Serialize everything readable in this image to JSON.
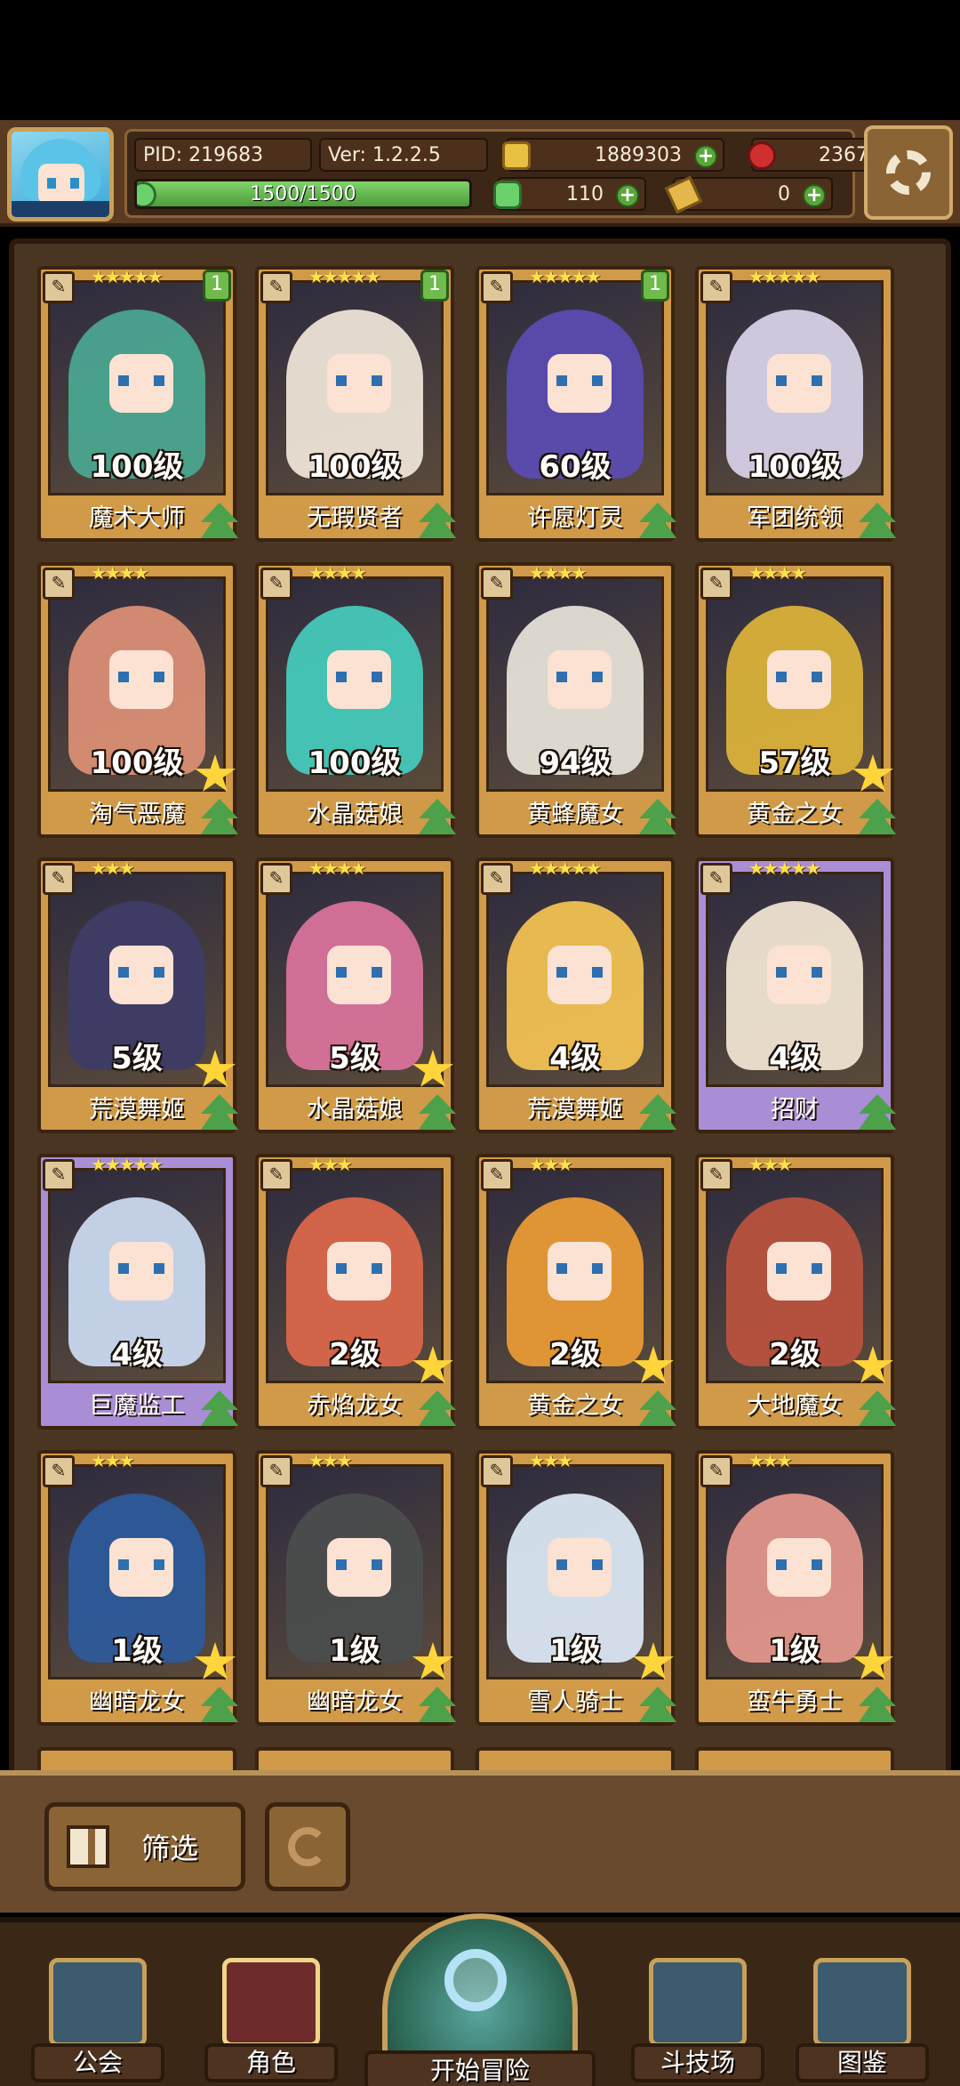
{
  "header": {
    "pid": "PID: 219683",
    "version": "Ver: 1.2.2.5",
    "gold": "1889303",
    "gems": "2367",
    "energy": "1500/1500",
    "energy_fraction": 1.0,
    "clovers": "110",
    "tickets": "0",
    "icons": {
      "avatar": "player-avatar-icon",
      "settings": "gear-icon",
      "gold": "gold-coin-icon",
      "gem": "red-gem-icon",
      "clover": "clover-icon",
      "ticket": "ticket-icon",
      "energy": "energy-icon"
    }
  },
  "roster": [
    {
      "name": "魔术大师",
      "level": "100级",
      "stars": "★★★★★",
      "badge": "1",
      "hair": "#4aa58f",
      "frame": "gold",
      "fav": false
    },
    {
      "name": "无瑕贤者",
      "level": "100级",
      "stars": "★★★★★",
      "badge": "1",
      "hair": "#ece3d6",
      "frame": "gold",
      "fav": false
    },
    {
      "name": "许愿灯灵",
      "level": "60级",
      "stars": "★★★★★",
      "badge": "1",
      "hair": "#5b4bb0",
      "frame": "gold",
      "fav": false
    },
    {
      "name": "军团统领",
      "level": "100级",
      "stars": "★★★★★",
      "badge": "",
      "hair": "#d6d0e6",
      "frame": "gold",
      "fav": false
    },
    {
      "name": "淘气恶魔",
      "level": "100级",
      "stars": "★★★★",
      "badge": "",
      "hair": "#d98e74",
      "frame": "gold",
      "fav": true
    },
    {
      "name": "水晶菇娘",
      "level": "100级",
      "stars": "★★★★",
      "badge": "",
      "hair": "#44c9b9",
      "frame": "gold",
      "fav": false
    },
    {
      "name": "黄蜂魔女",
      "level": "94级",
      "stars": "★★★★",
      "badge": "",
      "hair": "#e5e0d6",
      "frame": "gold",
      "fav": false
    },
    {
      "name": "黄金之女",
      "level": "57级",
      "stars": "★★★★",
      "badge": "",
      "hair": "#d9b13a",
      "frame": "gold",
      "fav": true
    },
    {
      "name": "荒漠舞姬",
      "level": "5级",
      "stars": "★★★",
      "badge": "",
      "hair": "#3e3c66",
      "frame": "gold",
      "fav": true
    },
    {
      "name": "水晶菇娘",
      "level": "5级",
      "stars": "★★★★",
      "badge": "",
      "hair": "#d8729a",
      "frame": "gold",
      "fav": true
    },
    {
      "name": "荒漠舞姬",
      "level": "4级",
      "stars": "★★★★★",
      "badge": "",
      "hair": "#f0c152",
      "frame": "gold",
      "fav": false
    },
    {
      "name": "招财",
      "level": "4级",
      "stars": "★★★★★",
      "badge": "",
      "hair": "#efe3d1",
      "frame": "purple",
      "fav": false
    },
    {
      "name": "巨魔监工",
      "level": "4级",
      "stars": "★★★★★",
      "badge": "",
      "hair": "#c9d8ee",
      "frame": "purple",
      "fav": false
    },
    {
      "name": "赤焰龙女",
      "level": "2级",
      "stars": "★★★",
      "badge": "",
      "hair": "#d9664a",
      "frame": "gold",
      "fav": true
    },
    {
      "name": "黄金之女",
      "level": "2级",
      "stars": "★★★",
      "badge": "",
      "hair": "#e89a35",
      "frame": "gold",
      "fav": true
    },
    {
      "name": "大地魔女",
      "level": "2级",
      "stars": "★★★",
      "badge": "",
      "hair": "#b8523e",
      "frame": "gold",
      "fav": true
    },
    {
      "name": "幽暗龙女",
      "level": "1级",
      "stars": "★★★",
      "badge": "",
      "hair": "#2d5a9a",
      "frame": "gold",
      "fav": true
    },
    {
      "name": "幽暗龙女",
      "level": "1级",
      "stars": "★★★",
      "badge": "",
      "hair": "#4b4d4d",
      "frame": "gold",
      "fav": true
    },
    {
      "name": "雪人骑士",
      "level": "1级",
      "stars": "★★★",
      "badge": "",
      "hair": "#d9e6f2",
      "frame": "gold",
      "fav": true
    },
    {
      "name": "蛮牛勇士",
      "level": "1级",
      "stars": "★★★",
      "badge": "",
      "hair": "#e0958a",
      "frame": "gold",
      "fav": true
    }
  ],
  "controls": {
    "filter_label": "筛选",
    "filter_icon": "grid-icon",
    "reset_icon": "refresh-icon"
  },
  "nav": {
    "guild": "公会",
    "characters": "角色",
    "adventure": "开始冒险",
    "arena": "斗技场",
    "codex": "图鉴"
  }
}
